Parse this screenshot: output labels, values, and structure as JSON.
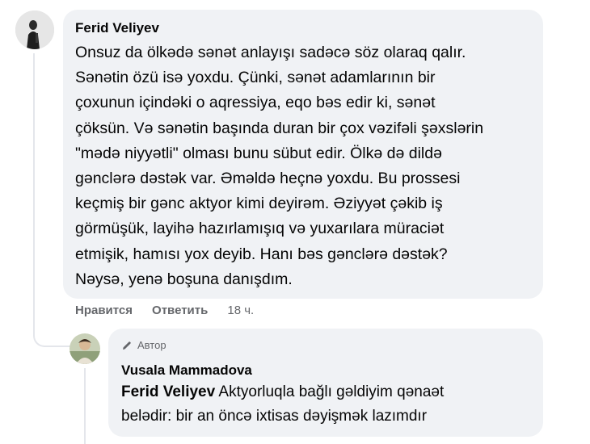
{
  "comment": {
    "author": "Ferid Veliyev",
    "text": "Onsuz da ölkədə sənət anlayışı sadəcə söz olaraq qalır.\nSənətin özü isə yoxdu. Çünki, sənət adamlarının bir\nçoxunun içindəki o aqressiya, eqo bəs edir ki, sənət\nçöksün. Və sənətin başında duran bir çox vəzifəli şəxslərin\n\"mədə niyyətli\" olması bunu sübut edir. Ölkə də dildə\ngənclərə dəstək var. Əməldə heçnə yoxdu. Bu prossesi\nkeçmiş bir gənc aktyor kimi deyirəm. Əziyyət çəkib iş\ngörmüşük, layihə hazırlamışıq və yuxarılara müraciət\netmişik, hamısı yox deyib. Hanı bəs gənclərə dəstək?\nNəysə, yenə boşuna danışdım.",
    "actions": {
      "like": "Нравится",
      "reply": "Ответить",
      "time": "18 ч."
    }
  },
  "reply": {
    "badge": "Автор",
    "author": "Vusala Mammadova",
    "mention": "Ferid Veliyev",
    "text_line1": "Aktyorluqla bağlı gəldiyim qənaət",
    "text_line2": "belədir: bir an öncə ixtisas dəyişmək lazımdır"
  },
  "colors": {
    "bubble": "#f0f2f5",
    "meta": "#65676b",
    "text": "#050505"
  },
  "icons": {
    "main_avatar": "user-photo-avatar",
    "reply_avatar": "user-photo-avatar",
    "badge_icon": "pencil-icon"
  }
}
